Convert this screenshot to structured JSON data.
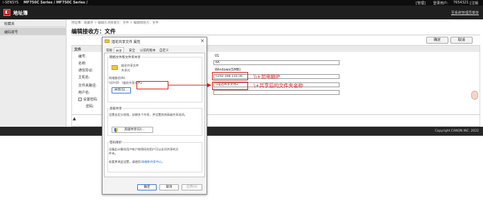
{
  "topbar": {
    "brand": "i-SENSYS",
    "model_left": "MF750C Series / MF750C Series /",
    "mode": "[管理]",
    "login_label": "登录用户:",
    "login_id": "7654321",
    "logout": "[注销"
  },
  "header": {
    "app_title": "地址簿",
    "right_link": "至系统管理员菜单"
  },
  "sidebar": {
    "items": [
      {
        "label": "收藏夹"
      },
      {
        "label": "编码拨号"
      }
    ]
  },
  "breadcrumb": "地址簿：收藏夹 > 编辑方决接收方：文件 > 编辑接收方：文件",
  "page_title": "编辑接收方：文件",
  "actions": {
    "ok": "确定",
    "cancel": "取消"
  },
  "form": {
    "section_label": "文件",
    "fields": [
      {
        "label": "编号:",
        "value": "01"
      },
      {
        "label": "名称:",
        "value": "KK"
      },
      {
        "label": "通信协议:",
        "value": "Windows(SMB)"
      },
      {
        "label": "主机名:",
        "value": "\\\\192.168.110.56"
      },
      {
        "label": "文件夹路径:",
        "value": "\\\\电话共享文件2"
      },
      {
        "label": "用户名:",
        "value": ""
      },
      {
        "label": "设置密码",
        "value": ""
      },
      {
        "label": "密码:",
        "value": ""
      }
    ],
    "bottom_mark": "▲"
  },
  "footer": {
    "copyright": "Copyright CANON INC. 2022"
  },
  "dialog": {
    "title": "插花共享文件 属性",
    "close": "×",
    "tabs": [
      "常规",
      "共享",
      "安全",
      "以前的版本",
      "自定义"
    ],
    "active_tab": 1,
    "network_group_title": "网络文件和文件夹共享",
    "share_name": "插花共享文件",
    "share_state": "共享式",
    "network_path_label": "网络路径(N):",
    "network_path": "\\\\GY-00",
    "network_path_tail": "\\插花共享文件2",
    "share_button": "共享(S)...",
    "advanced_title": "高级共享",
    "advanced_text": "设置自定义权限，创建多个共享，并设置其他高级共享选项。",
    "advanced_button": "高级共享(D)...",
    "password_title": "密码保护",
    "password_text_1": "设备此计算机用户帐户和密码的用户可以访问共享的文",
    "password_text_2": "件夹。",
    "password_text_3": "若要更改此设置，请使用",
    "password_link": "网络和共享中心。",
    "ok": "确定",
    "cancel": "取消",
    "apply": "应用(A)"
  },
  "annotations": {
    "host_note": "\\\\+加电脑IP",
    "folder_note": "\\+共享后的文件夹名称",
    "color": "#e01b1b"
  }
}
